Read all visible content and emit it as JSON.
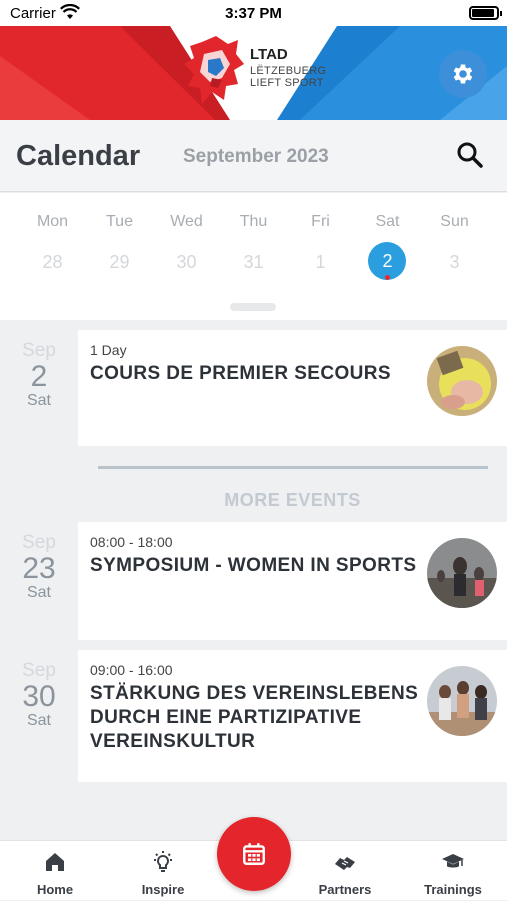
{
  "status": {
    "carrier": "Carrier",
    "time": "3:37 PM"
  },
  "brand": {
    "title": "LTAD",
    "line1": "LËTZEBUERG",
    "line2": "LIEFT SPORT",
    "red": "#e1262c",
    "blue": "#1d7fd0"
  },
  "header": {
    "title": "Calendar",
    "month": "September 2023"
  },
  "week": {
    "days": [
      {
        "name": "Mon",
        "num": "28"
      },
      {
        "name": "Tue",
        "num": "29"
      },
      {
        "name": "Wed",
        "num": "30"
      },
      {
        "name": "Thu",
        "num": "31"
      },
      {
        "name": "Fri",
        "num": "1"
      },
      {
        "name": "Sat",
        "num": "2"
      },
      {
        "name": "Sun",
        "num": "3"
      }
    ],
    "selected_index": 5
  },
  "events": [
    {
      "month": "Sep",
      "day": "2",
      "weekday": "Sat",
      "time": "1 Day",
      "title": "COURS DE PREMIER SECOURS"
    },
    {
      "month": "Sep",
      "day": "23",
      "weekday": "Sat",
      "time": "08:00 - 18:00",
      "title": "SYMPOSIUM - WOMEN IN SPORTS"
    },
    {
      "month": "Sep",
      "day": "30",
      "weekday": "Sat",
      "time": "09:00 - 16:00",
      "title": "STÄRKUNG DES VEREINSLEBENS DURCH EINE PARTIZIPATIVE VEREINSKULTUR"
    }
  ],
  "more_events_label": "MORE EVENTS",
  "tabs": [
    {
      "label": "Home",
      "icon": "home-icon"
    },
    {
      "label": "Inspire",
      "icon": "lightbulb-icon"
    },
    {
      "label": "Partners",
      "icon": "handshake-icon"
    },
    {
      "label": "Trainings",
      "icon": "graduation-cap-icon"
    }
  ],
  "accent": "#2b9ee0",
  "fab_color": "#e4262c"
}
